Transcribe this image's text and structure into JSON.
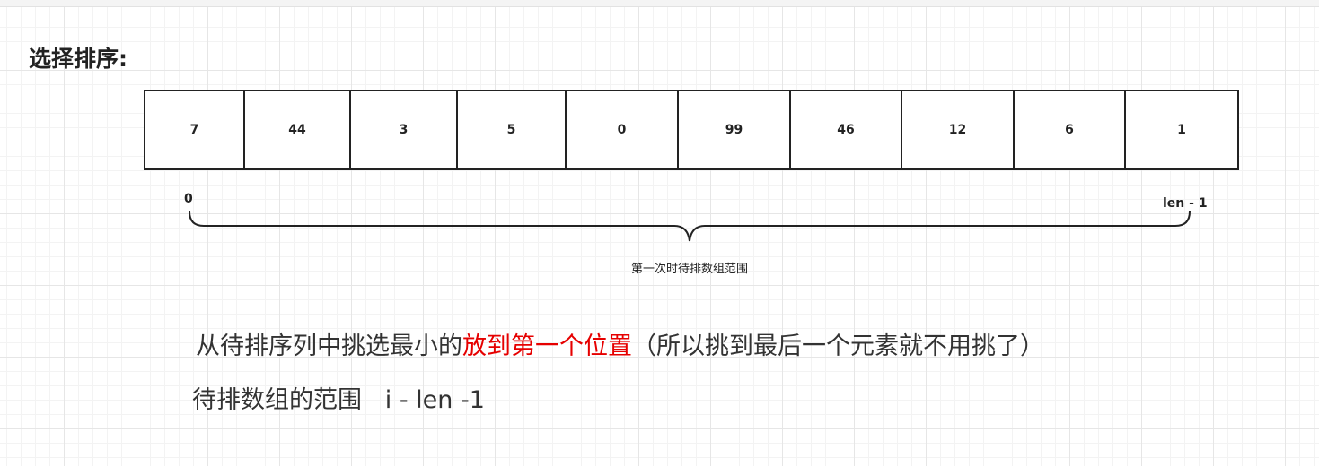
{
  "heading": "选择排序:",
  "array": {
    "values": [
      "7",
      "44",
      "3",
      "5",
      "0",
      "99",
      "46",
      "12",
      "6",
      "1"
    ]
  },
  "range": {
    "start_label": "0",
    "end_label": "len - 1",
    "caption": "第一次时待排数组范围"
  },
  "notes": {
    "line1_part1": "从待排序列中挑选最小的",
    "line1_highlight": "放到第一个位置",
    "line1_part2": "（所以挑到最后一个元素就不用挑了）",
    "line2": "待排数组的范围   i - len -1"
  },
  "colors": {
    "highlight": "#e60000",
    "stroke": "#222222"
  }
}
